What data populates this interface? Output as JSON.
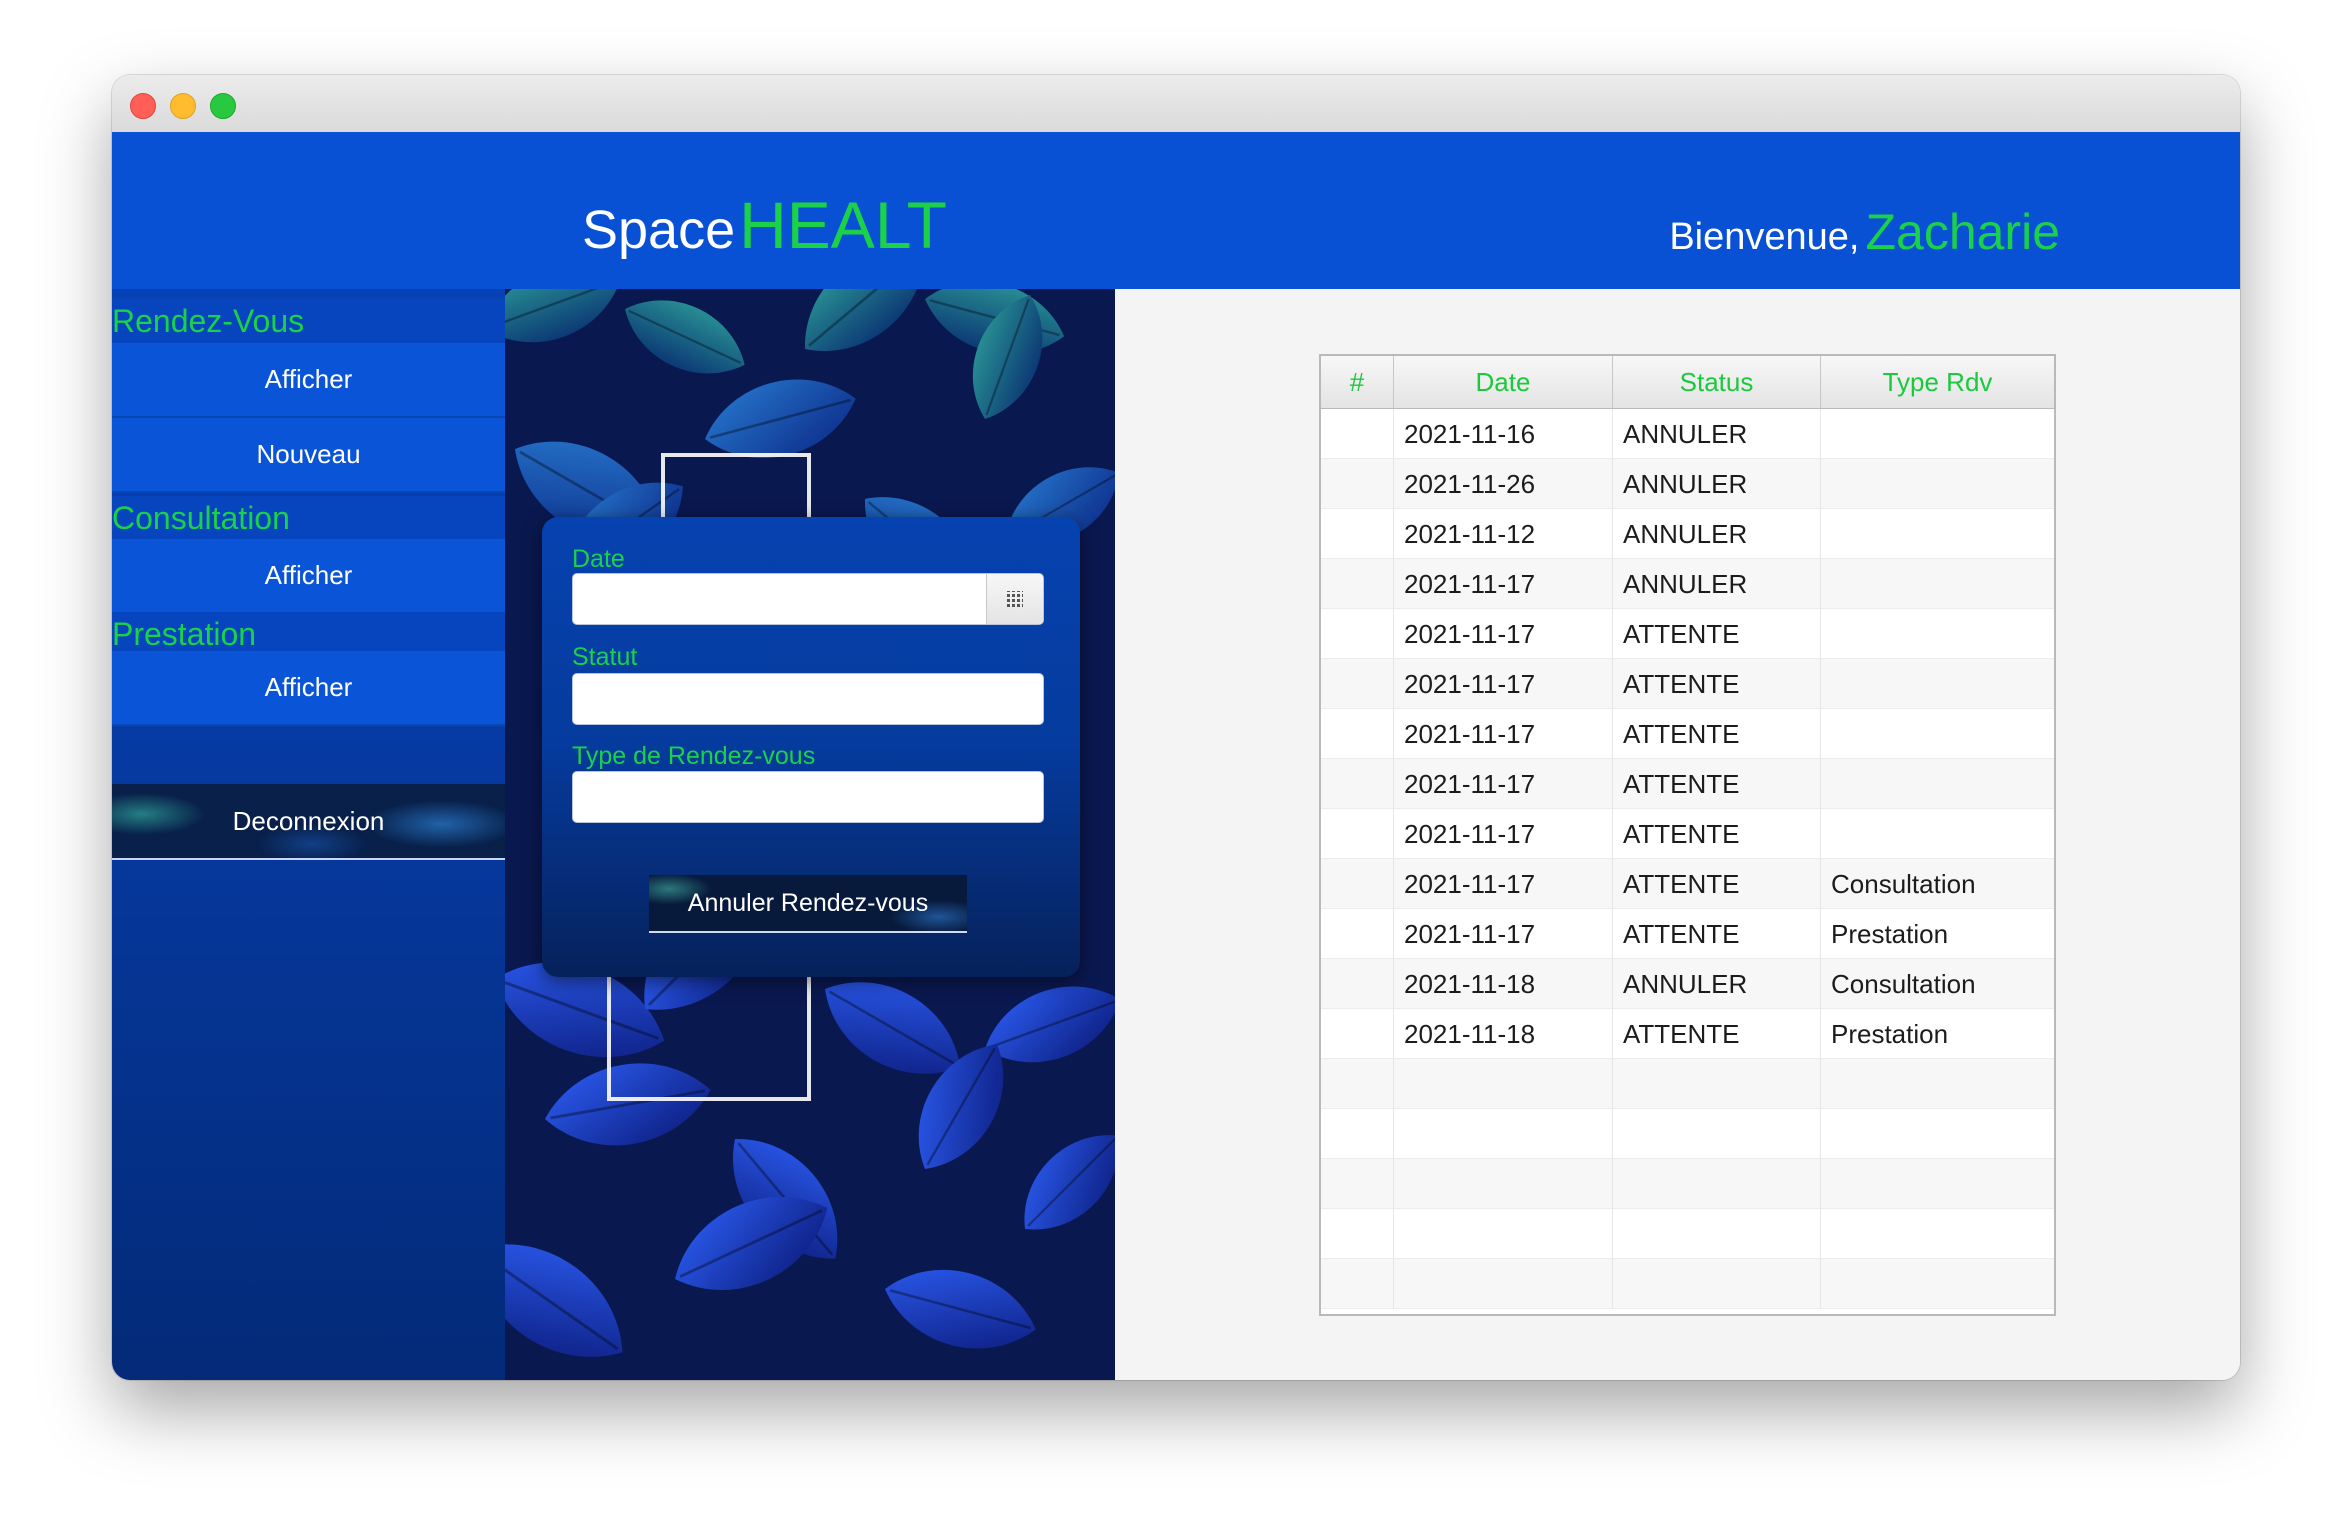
{
  "app": {
    "brand_first": "Space",
    "brand_second": "HEALT",
    "welcome_label": "Bienvenue,",
    "user_name": "Zacharie"
  },
  "colors": {
    "accent_green": "#1bd14a",
    "header_blue": "#0851d4",
    "sidebar_dark": "#042a78"
  },
  "sidebar": {
    "sections": [
      {
        "title": "Rendez-Vous",
        "items": [
          "Afficher",
          "Nouveau"
        ]
      },
      {
        "title": "Consultation",
        "items": [
          "Afficher"
        ]
      },
      {
        "title": "Prestation",
        "items": [
          "Afficher"
        ]
      }
    ],
    "logout_label": "Deconnexion"
  },
  "form": {
    "date_label": "Date",
    "date_value": "",
    "status_label": "Statut",
    "status_value": "",
    "type_label": "Type de Rendez-vous",
    "type_value": "",
    "calendar_icon": "calendar-icon",
    "submit_label": "Annuler Rendez-vous"
  },
  "table": {
    "columns": [
      "#",
      "Date",
      "Status",
      "Type Rdv"
    ],
    "rows": [
      [
        "",
        "2021-11-16",
        "ANNULER",
        ""
      ],
      [
        "",
        "2021-11-26",
        "ANNULER",
        ""
      ],
      [
        "",
        "2021-11-12",
        "ANNULER",
        ""
      ],
      [
        "",
        "2021-11-17",
        "ANNULER",
        ""
      ],
      [
        "",
        "2021-11-17",
        "ATTENTE",
        ""
      ],
      [
        "",
        "2021-11-17",
        "ATTENTE",
        ""
      ],
      [
        "",
        "2021-11-17",
        "ATTENTE",
        ""
      ],
      [
        "",
        "2021-11-17",
        "ATTENTE",
        ""
      ],
      [
        "",
        "2021-11-17",
        "ATTENTE",
        ""
      ],
      [
        "",
        "2021-11-17",
        "ATTENTE",
        "Consultation"
      ],
      [
        "",
        "2021-11-17",
        "ATTENTE",
        "Prestation"
      ],
      [
        "",
        "2021-11-18",
        "ANNULER",
        "Consultation"
      ],
      [
        "",
        "2021-11-18",
        "ATTENTE",
        "Prestation"
      ],
      [
        "",
        "",
        "",
        ""
      ],
      [
        "",
        "",
        "",
        ""
      ],
      [
        "",
        "",
        "",
        ""
      ],
      [
        "",
        "",
        "",
        ""
      ],
      [
        "",
        "",
        "",
        ""
      ]
    ]
  }
}
